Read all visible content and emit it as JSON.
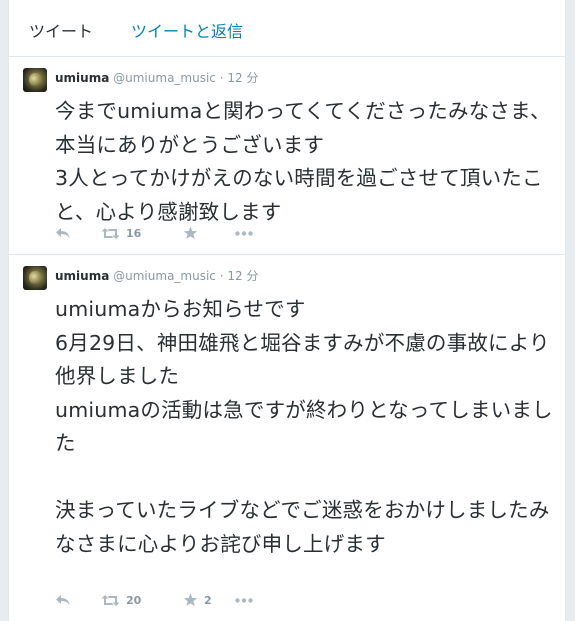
{
  "tabs": {
    "tweets": "ツイート",
    "tweets_and_replies": "ツイートと返信"
  },
  "tweets": [
    {
      "name": "umiuma",
      "handle": "@umiuma_music",
      "separator": "·",
      "time": "12 分",
      "text": "今までumiumaと関わってくてくださったみなさま、本当にありがとうございます\n3人とってかけがえのない時間を過ごさせて頂いたこと、心より感謝致します",
      "retweets": "16",
      "favorites": ""
    },
    {
      "name": "umiuma",
      "handle": "@umiuma_music",
      "separator": "·",
      "time": "12 分",
      "text": "umiumaからお知らせです\n6月29日、神田雄飛と堀谷ますみが不慮の事故により他界しました\numiumaの活動は急ですが終わりとなってしまいました\n\n決まっていたライブなどでご迷惑をおかけしましたみなさまに心よりお詫び申し上げます",
      "retweets": "20",
      "favorites": "2"
    }
  ],
  "icons": [
    "reply-icon",
    "retweet-icon",
    "favorite-icon",
    "more-icon"
  ],
  "colors": {
    "link": "#0084b4",
    "muted": "#8899a6",
    "icon": "#aab8c2",
    "background": "#e6ecf0"
  }
}
